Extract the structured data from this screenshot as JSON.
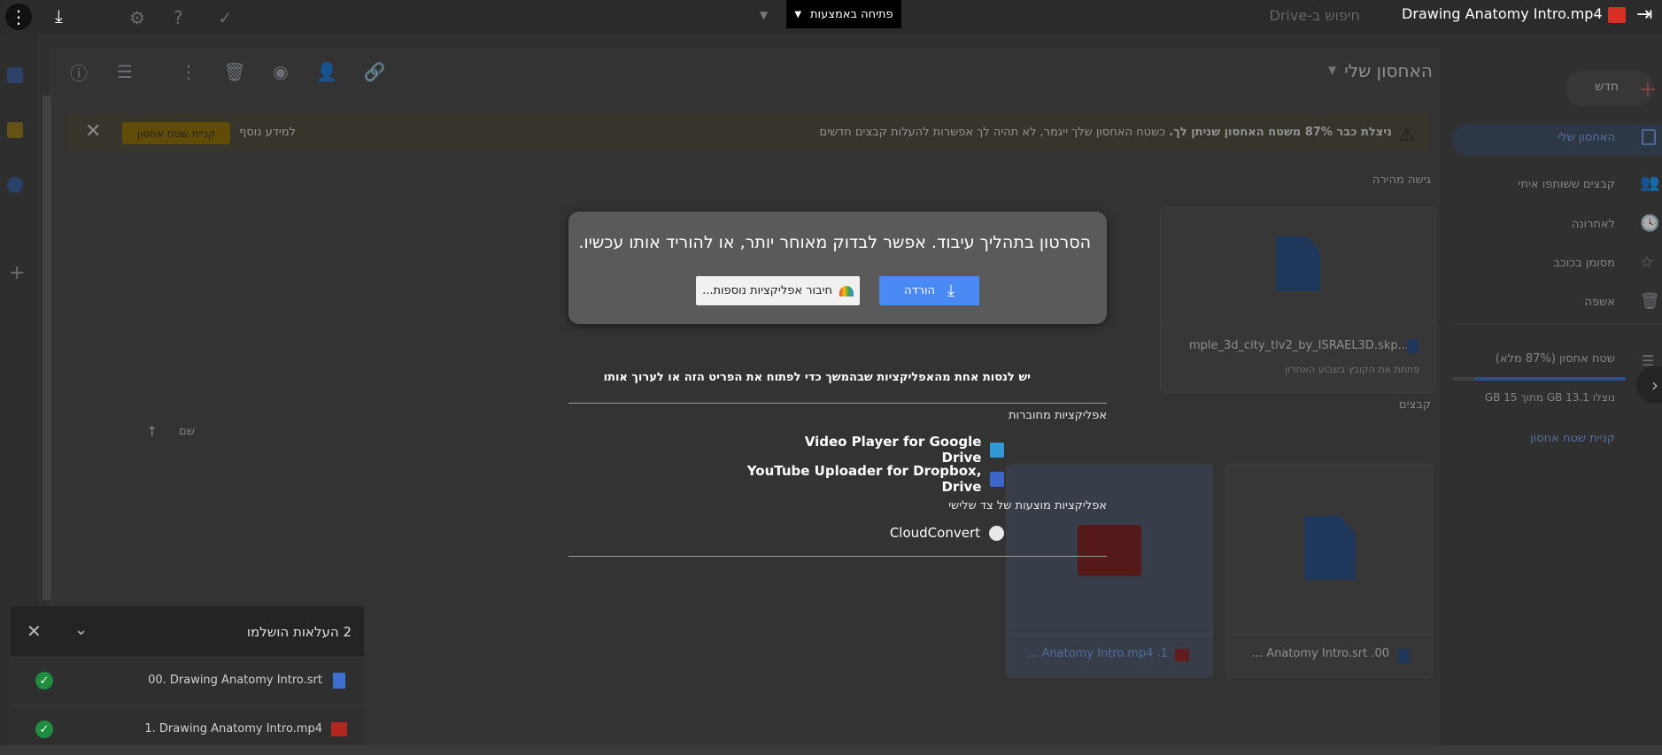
{
  "topbar": {
    "file_title": "1. Drawing Anatomy Intro.mp4",
    "open_with_label": "פתיחה באמצעות",
    "search_placeholder": "חיפוש ב-Drive"
  },
  "drive": {
    "location_title": "האחסון שלי",
    "new_button": "חדש",
    "nav": [
      {
        "label": "האחסון שלי"
      },
      {
        "label": "קבצים ששותפו איתי"
      },
      {
        "label": "לאחרונה"
      },
      {
        "label": "מסומן בכוכב"
      },
      {
        "label": "אשפה"
      }
    ],
    "storage": {
      "label": "שטח אחסון (87% מלא)",
      "used_text": "נוצלו 13.1 GB מתוך 15 GB",
      "buy_link": "קניית שטח אחסון",
      "fraction": 0.87
    },
    "banner": {
      "bold_text": "ניצלת כבר 87% משטח האחסון שניתן לך.",
      "text": " כשטח האחסון שלך ייגמר, לא תהיה לך אפשרות להעלות קבצים חדשים",
      "buy_button": "קניית שטח אחסון",
      "learn_more": "למידע נוסף"
    },
    "quick_access_label": "גישה מהירה",
    "quick_file": {
      "name": "...mple_3d_city_tlv2_by_ISRAEL3D.skp",
      "sub": "פתחת את הקובץ בשבוע האחרון"
    },
    "files_label": "קבצים",
    "name_column": "שם",
    "files": [
      {
        "name": "00. Anatomy Intro.srt ..."
      },
      {
        "name": "1. Anatomy Intro.mp4 ..."
      }
    ]
  },
  "preview": {
    "processing_message": "הסרטון בתהליך עיבוד. אפשר לבדוק מאוחר יותר, או להוריד אותו עכשיו.",
    "download_button": "הורדה",
    "connect_more_button": "חיבור אפליקציות נוספות...",
    "try_apps_text": "יש לנסות אחת מהאפליקציות שבהמשך כדי לפתוח את הפריט הזה או לערוך אותו",
    "connected_apps_heading": "אפליקציות מחוברות",
    "connected_apps": [
      {
        "label": "Video Player for Google Drive"
      },
      {
        "label": "YouTube Uploader for Dropbox, Drive"
      }
    ],
    "suggested_apps_heading": "אפליקציות מוצעות של צד שלישי",
    "suggested_apps": [
      {
        "label": "CloudConvert"
      }
    ]
  },
  "uploads": {
    "title": "2 העלאות הושלמו",
    "items": [
      {
        "name": "00. Drawing Anatomy Intro.srt"
      },
      {
        "name": "1. Drawing Anatomy Intro.mp4"
      }
    ]
  },
  "colors": {
    "accent": "#4a8af4",
    "warning": "#f9ab00",
    "success": "#1e8e3e",
    "video_red": "#d93025"
  }
}
